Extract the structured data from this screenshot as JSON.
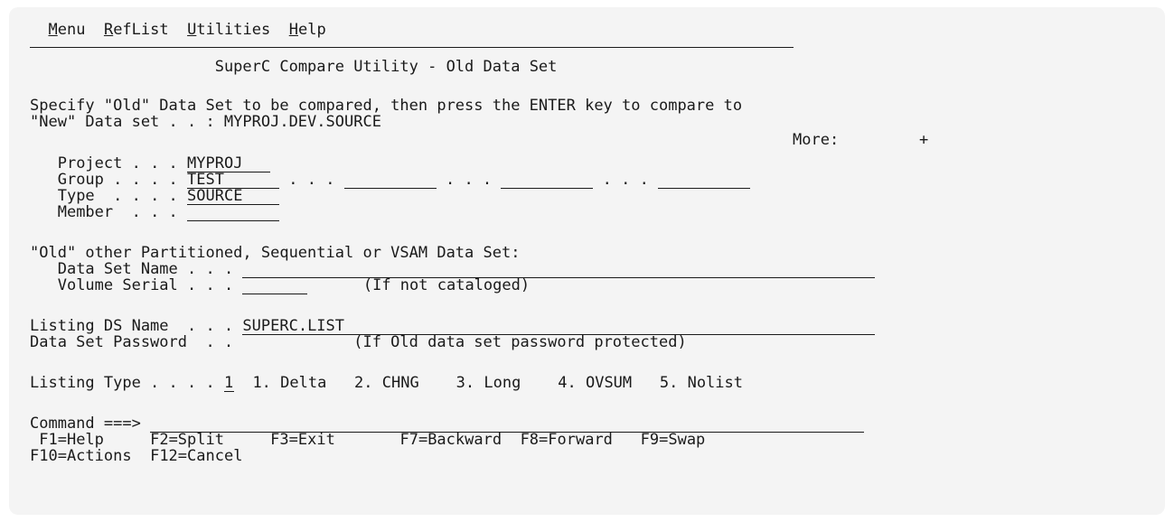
{
  "menubar": {
    "items": [
      {
        "accel": "M",
        "rest": "enu"
      },
      {
        "accel": "R",
        "rest": "efList"
      },
      {
        "accel": "U",
        "rest": "tilities"
      },
      {
        "accel": "H",
        "rest": "elp"
      }
    ]
  },
  "panel": {
    "title": "SuperC Compare Utility - Old Data Set",
    "instruction_line1": "Specify \"Old\" Data Set to be compared, then press the ENTER key to compare to",
    "instruction_line2": "\"New\" Data set . . : MYPROJ.DEV.SOURCE",
    "more_label": "More:",
    "more_indicator": "+"
  },
  "ispf_library": {
    "project_label": "Project . . .",
    "project_value": "MYPROJ",
    "group_label": "Group . . . .",
    "group_value": "TEST",
    "group_sep": ". . .",
    "type_label": "Type  . . . .",
    "type_value": "SOURCE",
    "member_label": "Member  . . ."
  },
  "other_dataset": {
    "heading": "\"Old\" other Partitioned, Sequential or VSAM Data Set:",
    "dsname_label": "Data Set Name . . .",
    "volser_label": "Volume Serial . . .",
    "volser_hint": "(If not cataloged)"
  },
  "listing": {
    "dsname_label": "Listing DS Name  . . .",
    "dsname_value": "SUPERC.LIST",
    "password_label": "Data Set Password  . .",
    "password_hint": "(If Old data set password protected)",
    "type_label": "Listing Type . . . .",
    "type_value": "1",
    "options": [
      "1. Delta",
      "2. CHNG",
      "3. Long",
      "4. OVSUM",
      "5. Nolist"
    ]
  },
  "command": {
    "label": "Command ===>"
  },
  "function_keys": {
    "row1": [
      "F1=Help",
      "F2=Split",
      "F3=Exit",
      "F7=Backward",
      "F8=Forward",
      "F9=Swap"
    ],
    "row2": [
      "F10=Actions",
      "F12=Cancel"
    ]
  }
}
